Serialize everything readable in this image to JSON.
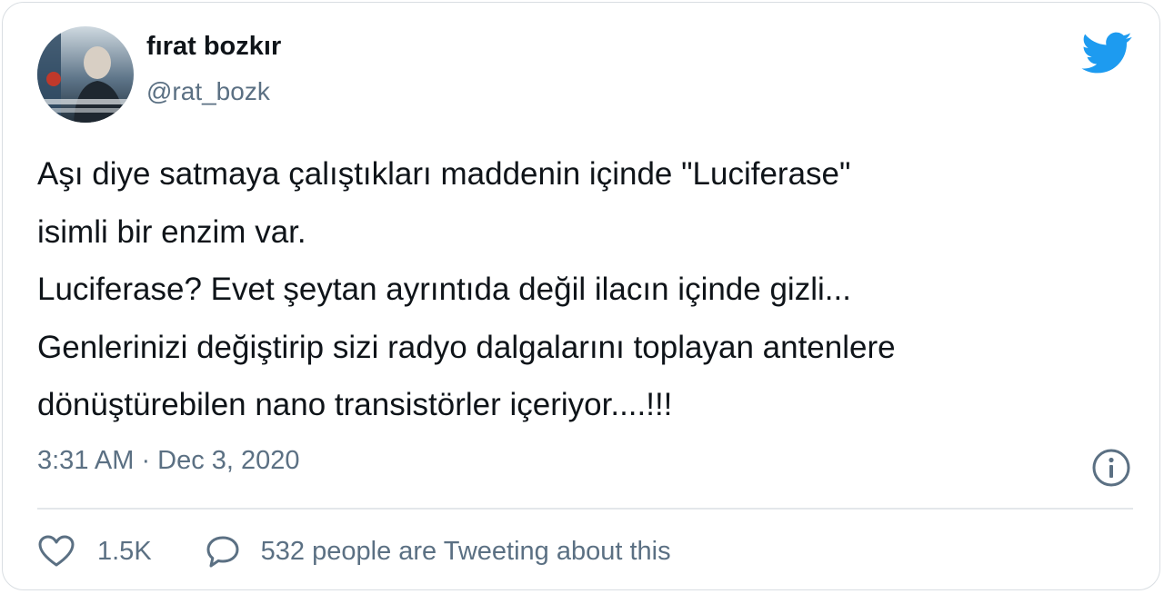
{
  "colors": {
    "text_primary": "#0f1419",
    "text_secondary": "#5b7083",
    "twitter_blue": "#1d9bf0",
    "border": "#d9dee2"
  },
  "author": {
    "display_name": "fırat bozkır",
    "handle": "@rat_bozk"
  },
  "icons": {
    "logo": "twitter-bird-icon",
    "info": "info-icon",
    "like": "heart-icon",
    "reply": "speech-bubble-icon"
  },
  "tweet": {
    "lines": [
      "Aşı diye satmaya çalıştıkları maddenin içinde \"Luciferase\"",
      "isimli bir enzim var.",
      "Luciferase? Evet şeytan ayrıntıda değil ilacın içinde gizli...",
      "Genlerinizi değiştirip sizi radyo dalgalarını toplayan antenlere",
      "dönüştürebilen nano transistörler içeriyor....!!!"
    ],
    "timestamp": "3:31 AM · Dec 3, 2020"
  },
  "actions": {
    "like_count": "1.5K",
    "tweeting_text": "532 people are Tweeting about this"
  }
}
